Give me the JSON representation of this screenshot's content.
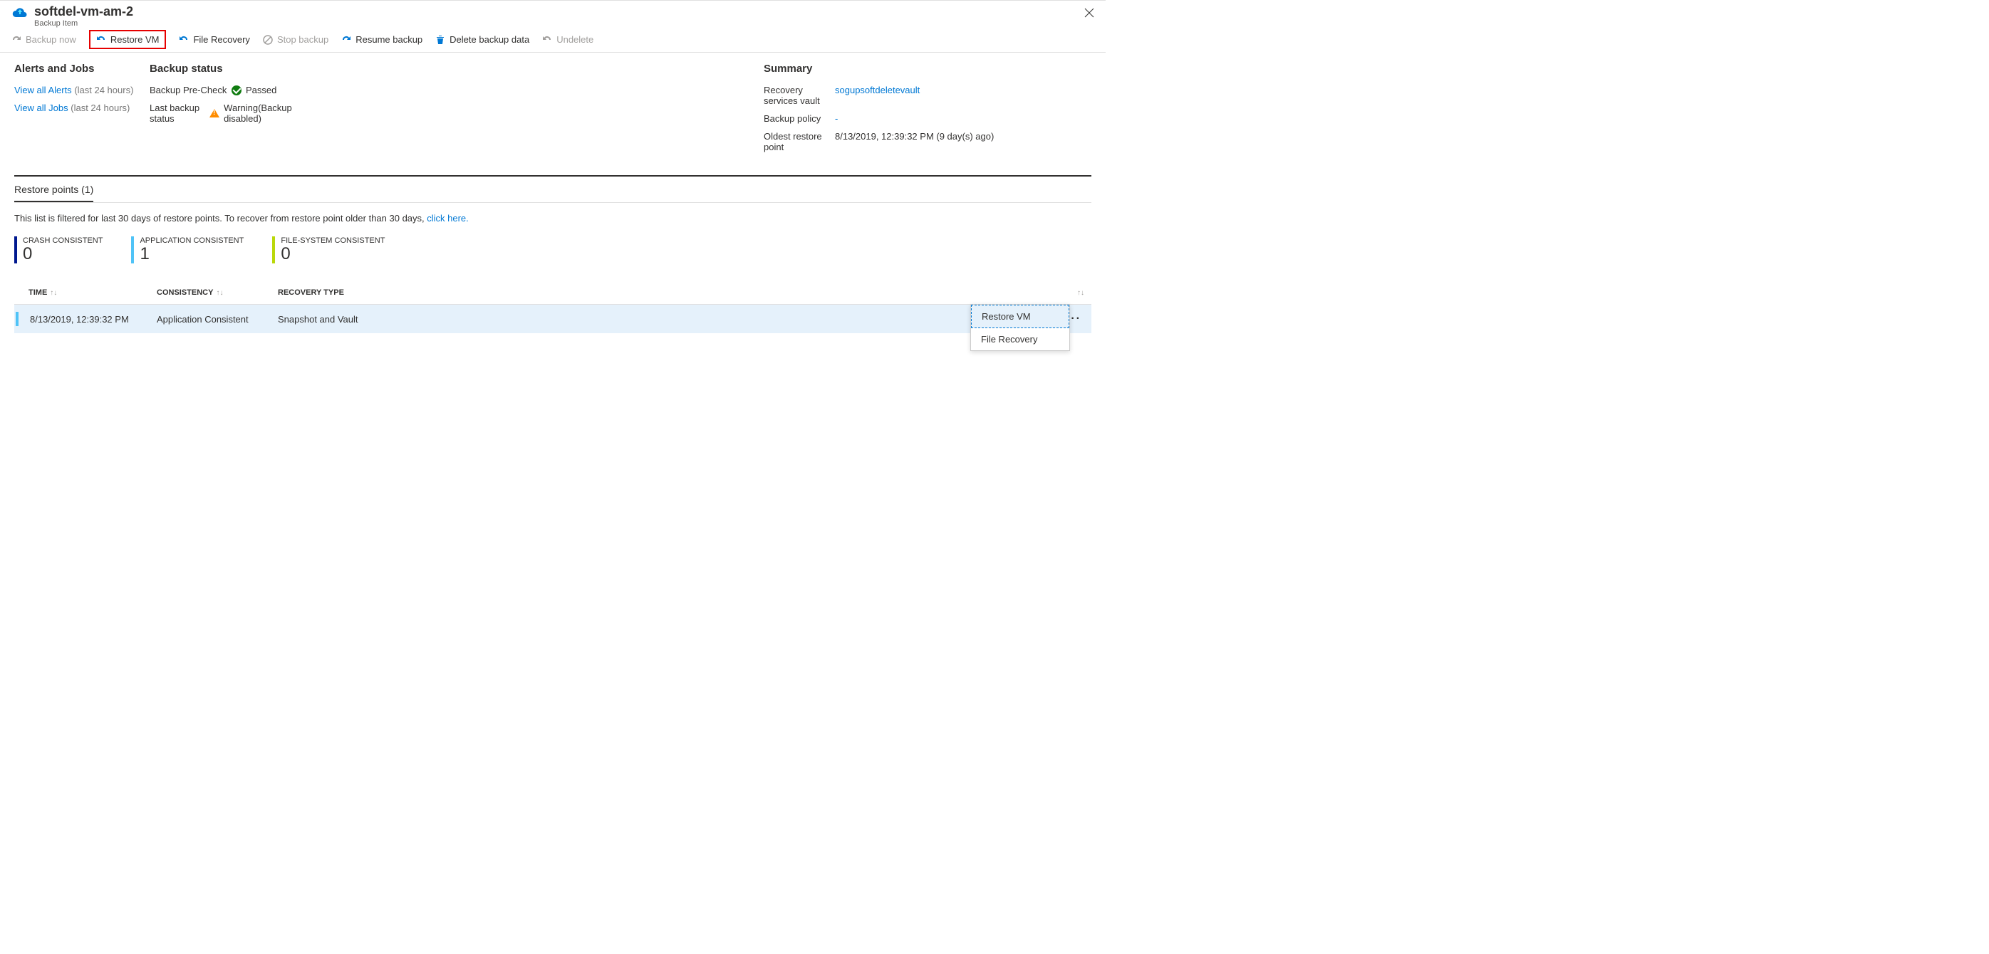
{
  "header": {
    "title": "softdel-vm-am-2",
    "subtitle": "Backup Item"
  },
  "toolbar": {
    "backup_now": "Backup now",
    "restore_vm": "Restore VM",
    "file_recovery": "File Recovery",
    "stop_backup": "Stop backup",
    "resume_backup": "Resume backup",
    "delete_backup_data": "Delete backup data",
    "undelete": "Undelete"
  },
  "alerts": {
    "heading": "Alerts and Jobs",
    "view_alerts": "View all Alerts",
    "view_alerts_suffix": "(last 24 hours)",
    "view_jobs": "View all Jobs",
    "view_jobs_suffix": "(last 24 hours)"
  },
  "status": {
    "heading": "Backup status",
    "precheck_label": "Backup Pre-Check",
    "precheck_value": "Passed",
    "last_label": "Last backup status",
    "last_value": "Warning(Backup disabled)"
  },
  "summary": {
    "heading": "Summary",
    "vault_label": "Recovery services vault",
    "vault_value": "sogupsoftdeletevault",
    "policy_label": "Backup policy",
    "policy_value": "-",
    "oldest_label": "Oldest restore point",
    "oldest_value": "8/13/2019, 12:39:32 PM (9 day(s) ago)"
  },
  "tabs": {
    "restore_points": "Restore points (1)"
  },
  "filter_note": {
    "text": "This list is filtered for last 30 days of restore points. To recover from restore point older than 30 days, ",
    "link": "click here."
  },
  "stats": {
    "crash_label": "CRASH CONSISTENT",
    "crash_value": "0",
    "app_label": "APPLICATION CONSISTENT",
    "app_value": "1",
    "fs_label": "FILE-SYSTEM CONSISTENT",
    "fs_value": "0"
  },
  "grid": {
    "col_time": "TIME",
    "col_consistency": "CONSISTENCY",
    "col_recovery": "RECOVERY TYPE",
    "row1": {
      "time": "8/13/2019, 12:39:32 PM",
      "consistency": "Application Consistent",
      "recovery": "Snapshot and Vault"
    }
  },
  "context_menu": {
    "restore_vm": "Restore VM",
    "file_recovery": "File Recovery"
  }
}
